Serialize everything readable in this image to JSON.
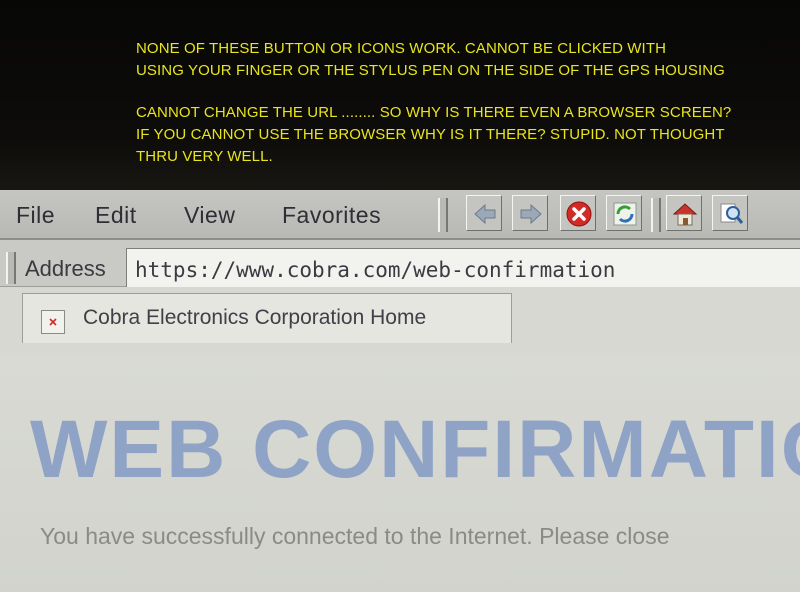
{
  "annotation": {
    "lines": [
      "NONE OF THESE BUTTON OR ICONS WORK.  CANNOT BE CLICKED WITH",
      "USING YOUR FINGER OR THE STYLUS PEN ON THE SIDE OF THE GPS HOUSING",
      "CANNOT CHANGE THE URL ........ SO WHY IS THERE EVEN A BROWSER SCREEN?",
      "IF YOU CANNOT USE THE BROWSER WHY IS IT THERE?  STUPID.  NOT THOUGHT",
      "THRU VERY WELL."
    ],
    "color": "#e8e51c"
  },
  "menu": {
    "file": "File",
    "edit": "Edit",
    "view": "View",
    "favorites": "Favorites"
  },
  "toolbar": {
    "icons": [
      "back-arrow-icon",
      "forward-arrow-icon",
      "stop-icon",
      "refresh-icon",
      "home-icon",
      "search-icon"
    ]
  },
  "address": {
    "label": "Address",
    "url": "https://www.cobra.com/web-confirmation"
  },
  "tab": {
    "title": "Cobra Electronics Corporation Home"
  },
  "page": {
    "heading": "WEB CONFIRMATIO",
    "body": "You have successfully connected to the Internet.  Please close",
    "heading_color": "#8fa3c6"
  }
}
